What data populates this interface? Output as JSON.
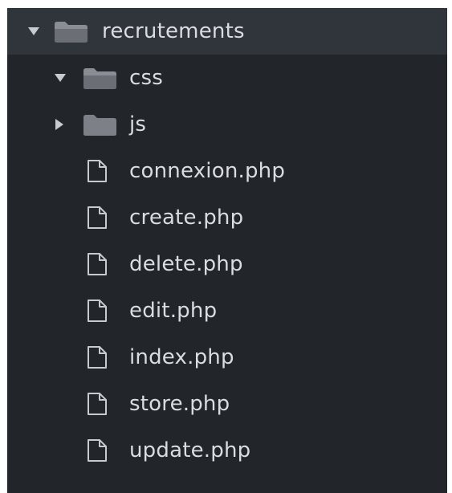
{
  "tree": {
    "root": {
      "label": "recrutements",
      "expanded": true,
      "icon": "folder-open-icon"
    },
    "css": {
      "label": "css",
      "expanded": true,
      "icon": "folder-open-icon"
    },
    "js": {
      "label": "js",
      "expanded": false,
      "icon": "folder-icon"
    },
    "files": [
      {
        "label": "connexion.php",
        "icon": "file-icon"
      },
      {
        "label": "create.php",
        "icon": "file-icon"
      },
      {
        "label": "delete.php",
        "icon": "file-icon"
      },
      {
        "label": "edit.php",
        "icon": "file-icon"
      },
      {
        "label": "index.php",
        "icon": "file-icon"
      },
      {
        "label": "store.php",
        "icon": "file-icon"
      },
      {
        "label": "update.php",
        "icon": "file-icon"
      }
    ]
  },
  "colors": {
    "panel_background": "#22252a",
    "selected_row": "#30343b",
    "text": "#d9dce1",
    "folder": "#8a8d93"
  }
}
